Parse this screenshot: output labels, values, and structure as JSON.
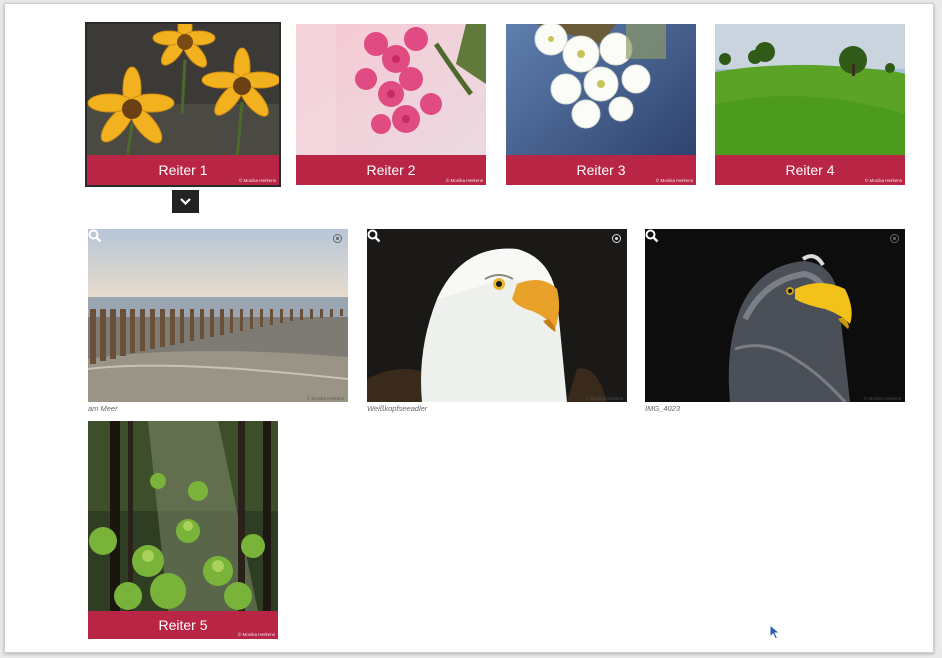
{
  "tabs": [
    {
      "label": "Reiter 1",
      "credit": "© Monika Herkens"
    },
    {
      "label": "Reiter 2",
      "credit": "© Monika Herkens"
    },
    {
      "label": "Reiter 3",
      "credit": "© Monika Herkens"
    },
    {
      "label": "Reiter 4",
      "credit": "© Monika Herkens"
    },
    {
      "label": "Reiter 5",
      "credit": "© Monika Herkens"
    }
  ],
  "gallery": [
    {
      "caption": "am Meer",
      "credit": "© Monika Herkens"
    },
    {
      "caption": "Weißkopfseeadler",
      "credit": "© Monika Herkens"
    },
    {
      "caption": "IMG_4023",
      "credit": "© Monika Herkens"
    }
  ],
  "icons": {
    "expand": "chevron-down-icon",
    "zoom": "magnifier-icon",
    "info": "info-icon",
    "cursor": "mouse-pointer-icon"
  },
  "colors": {
    "tab_bar": "#b82545",
    "chevron_bg": "#222222",
    "page_bg": "#ffffff"
  }
}
